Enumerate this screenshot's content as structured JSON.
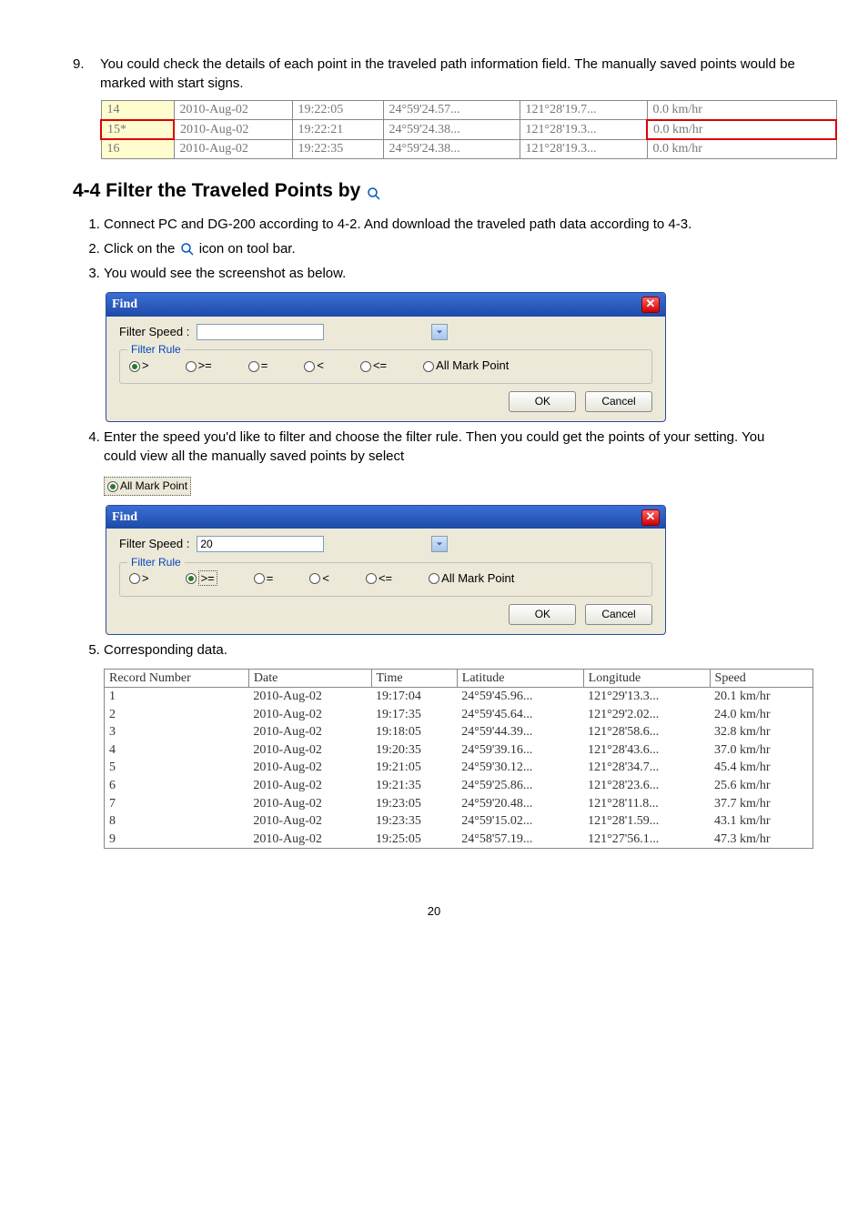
{
  "item9": {
    "num": "9.",
    "text": "You could check the details of each point in the traveled path information field. The manually saved points would be marked with start signs."
  },
  "smallTable": [
    [
      "14",
      "2010-Aug-02",
      "19:22:05",
      "24°59'24.57...",
      "121°28'19.7...",
      "0.0 km/hr"
    ],
    [
      "15*",
      "2010-Aug-02",
      "19:22:21",
      "24°59'24.38...",
      "121°28'19.3...",
      "0.0 km/hr"
    ],
    [
      "16",
      "2010-Aug-02",
      "19:22:35",
      "24°59'24.38...",
      "121°28'19.3...",
      "0.0 km/hr"
    ]
  ],
  "heading": "4-4 Filter the Traveled Points by",
  "steps14": {
    "s1": "Connect PC and DG-200 according to 4-2. And download the traveled path data according to 4-3.",
    "s2a": "Click on the",
    "s2b": "icon on tool bar.",
    "s3": "You would see the screenshot as below."
  },
  "find1": {
    "title": "Find",
    "speedLabel": "Filter Speed :",
    "speedValue": "",
    "ruleLegend": "Filter Rule",
    "opts": {
      "gt": ">",
      "gte": ">=",
      "eq": "=",
      "lt": "<",
      "lte": "<=",
      "all": "All Mark Point"
    },
    "ok": "OK",
    "cancel": "Cancel"
  },
  "step4": "Enter the speed you'd like to filter and choose the filter rule. Then you could get the points of your setting. You could view all the manually saved points by select",
  "allmarkInline": "All Mark Point",
  "find2": {
    "title": "Find",
    "speedLabel": "Filter Speed :",
    "speedValue": "20",
    "ruleLegend": "Filter Rule",
    "opts": {
      "gt": ">",
      "gte": ">=",
      "eq": "=",
      "lt": "<",
      "lte": "<=",
      "all": "All Mark Point"
    },
    "ok": "OK",
    "cancel": "Cancel"
  },
  "step5": "Corresponding data.",
  "dataHeaders": [
    "Record Number",
    "Date",
    "Time",
    "Latitude",
    "Longitude",
    "Speed"
  ],
  "dataRows": [
    [
      "1",
      "2010-Aug-02",
      "19:17:04",
      "24°59'45.96...",
      "121°29'13.3...",
      "20.1 km/hr"
    ],
    [
      "2",
      "2010-Aug-02",
      "19:17:35",
      "24°59'45.64...",
      "121°29'2.02...",
      "24.0 km/hr"
    ],
    [
      "3",
      "2010-Aug-02",
      "19:18:05",
      "24°59'44.39...",
      "121°28'58.6...",
      "32.8 km/hr"
    ],
    [
      "4",
      "2010-Aug-02",
      "19:20:35",
      "24°59'39.16...",
      "121°28'43.6...",
      "37.0 km/hr"
    ],
    [
      "5",
      "2010-Aug-02",
      "19:21:05",
      "24°59'30.12...",
      "121°28'34.7...",
      "45.4 km/hr"
    ],
    [
      "6",
      "2010-Aug-02",
      "19:21:35",
      "24°59'25.86...",
      "121°28'23.6...",
      "25.6 km/hr"
    ],
    [
      "7",
      "2010-Aug-02",
      "19:23:05",
      "24°59'20.48...",
      "121°28'11.8...",
      "37.7 km/hr"
    ],
    [
      "8",
      "2010-Aug-02",
      "19:23:35",
      "24°59'15.02...",
      "121°28'1.59...",
      "43.1 km/hr"
    ],
    [
      "9",
      "2010-Aug-02",
      "19:25:05",
      "24°58'57.19...",
      "121°27'56.1...",
      "47.3 km/hr"
    ]
  ],
  "pageNum": "20"
}
